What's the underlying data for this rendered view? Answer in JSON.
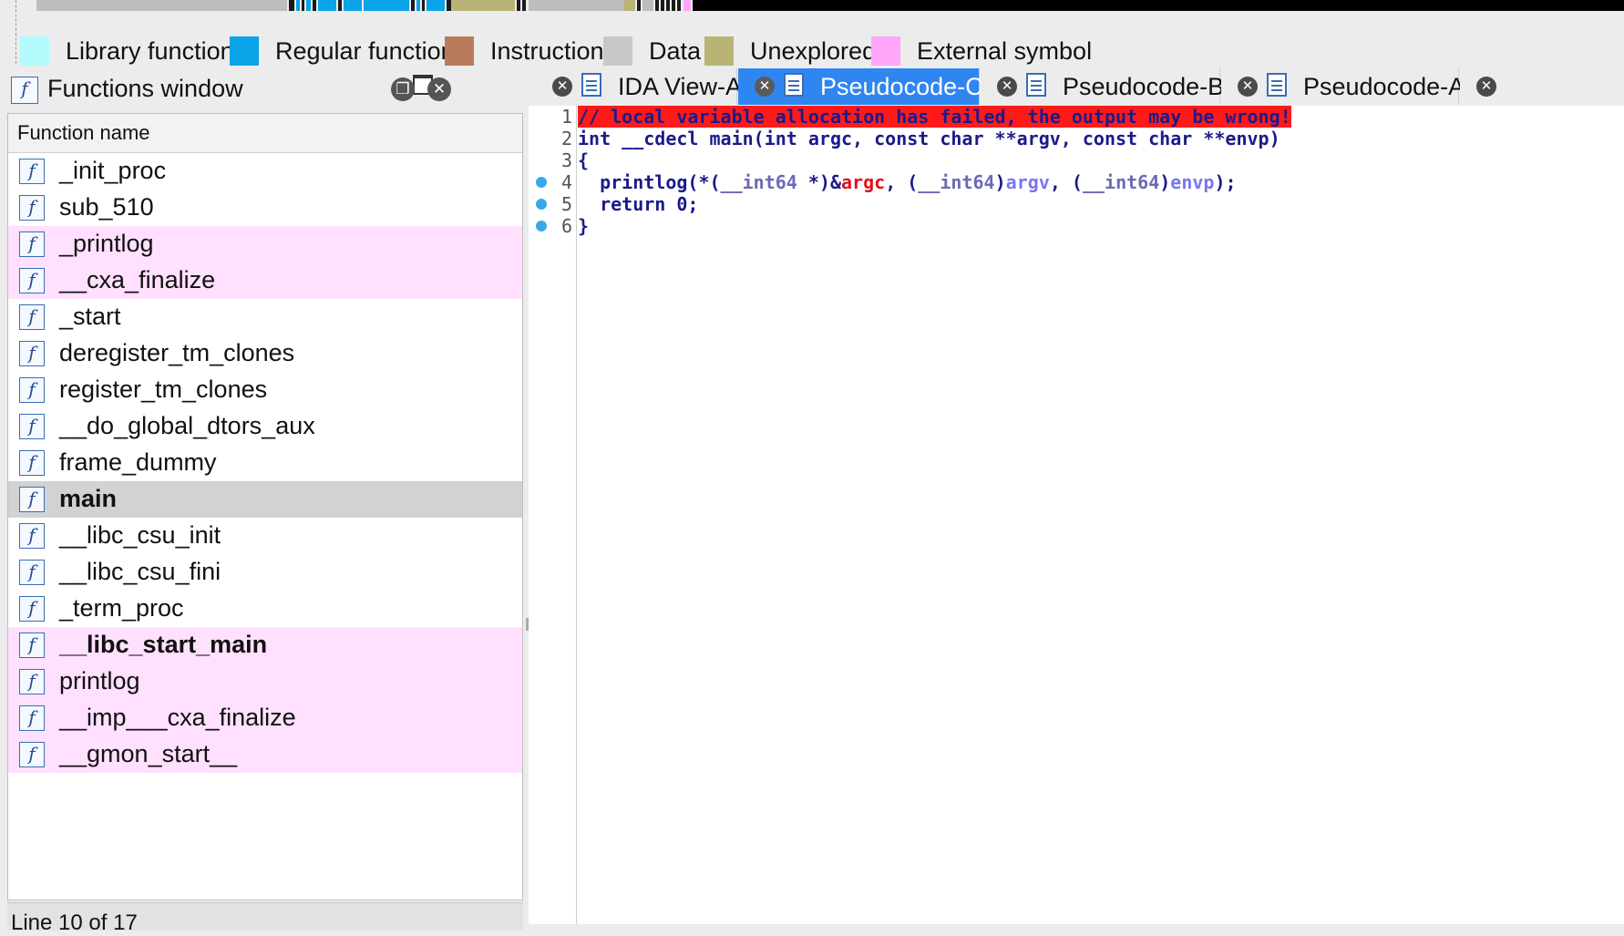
{
  "legend": [
    {
      "label": "Library function",
      "color": "#b3fafc"
    },
    {
      "label": "Regular function",
      "color": "#0aa3e8"
    },
    {
      "label": "Instruction",
      "color": "#b87b5c"
    },
    {
      "label": "Data",
      "color": "#c8c8c8"
    },
    {
      "label": "Unexplored",
      "color": "#b9b476"
    },
    {
      "label": "External symbol",
      "color": "#ffa6fb"
    }
  ],
  "functions_window": {
    "title": "Functions window",
    "column_header": "Function name",
    "rows": [
      {
        "name": "_init_proc",
        "type": "regular"
      },
      {
        "name": "sub_510",
        "type": "regular"
      },
      {
        "name": "_printlog",
        "type": "external"
      },
      {
        "name": "__cxa_finalize",
        "type": "external"
      },
      {
        "name": "_start",
        "type": "regular"
      },
      {
        "name": "deregister_tm_clones",
        "type": "regular"
      },
      {
        "name": "register_tm_clones",
        "type": "regular"
      },
      {
        "name": "__do_global_dtors_aux",
        "type": "regular"
      },
      {
        "name": "frame_dummy",
        "type": "regular"
      },
      {
        "name": "main",
        "type": "selected"
      },
      {
        "name": "__libc_csu_init",
        "type": "regular"
      },
      {
        "name": "__libc_csu_fini",
        "type": "regular"
      },
      {
        "name": "_term_proc",
        "type": "regular"
      },
      {
        "name": "__libc_start_main",
        "type": "external-bold"
      },
      {
        "name": "printlog",
        "type": "external"
      },
      {
        "name": "__imp___cxa_finalize",
        "type": "external"
      },
      {
        "name": "__gmon_start__",
        "type": "external"
      }
    ],
    "status": "Line 10 of 17"
  },
  "tabs": [
    {
      "label": "IDA View-A",
      "active": false
    },
    {
      "label": "Pseudocode-C",
      "active": true
    },
    {
      "label": "Pseudocode-B",
      "active": false
    },
    {
      "label": "Pseudocode-A",
      "active": false
    }
  ],
  "code": {
    "lines": [
      {
        "num": "1",
        "bp": false,
        "text": "// local variable allocation has failed, the output may be wrong!"
      },
      {
        "num": "2",
        "bp": false,
        "text": "int __cdecl main(int argc, const char **argv, const char **envp)"
      },
      {
        "num": "3",
        "bp": false,
        "text": "{"
      },
      {
        "num": "4",
        "bp": true,
        "text": "  printlog(*(__int64 *)&argc, (__int64)argv, (__int64)envp);"
      },
      {
        "num": "5",
        "bp": true,
        "text": "  return 0;"
      },
      {
        "num": "6",
        "bp": true,
        "text": "}"
      }
    ]
  }
}
